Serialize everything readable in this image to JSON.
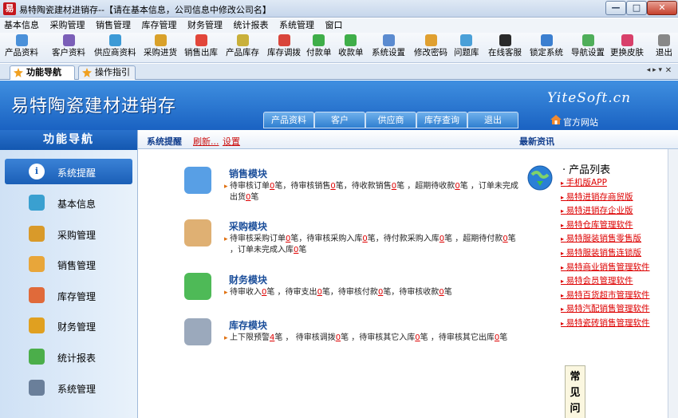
{
  "window": {
    "icon_text": "易",
    "title": "易特陶瓷建材进销存--【请在基本信息，公司信息中修改公司名】",
    "min": "—",
    "max": "□",
    "close": "✕"
  },
  "menu": [
    "基本信息",
    "采购管理",
    "销售管理",
    "库存管理",
    "财务管理",
    "统计报表",
    "系统管理",
    "窗口"
  ],
  "toolbar": [
    {
      "label": "产品资料",
      "icon": "product-icon",
      "color": "#4a90d9"
    },
    {
      "label": "客户资料",
      "icon": "customer-icon",
      "color": "#7b5fb8"
    },
    {
      "label": "供应商资料",
      "icon": "supplier-icon",
      "color": "#3c9ad6"
    },
    {
      "label": "采购进货",
      "icon": "purchase-icon",
      "color": "#d9a12a"
    },
    {
      "label": "销售出库",
      "icon": "sales-icon",
      "color": "#e2463a"
    },
    {
      "label": "产品库存",
      "icon": "stock-icon",
      "color": "#c9b03a"
    },
    {
      "label": "库存调拨",
      "icon": "transfer-icon",
      "color": "#d9453b"
    },
    {
      "label": "付款单",
      "icon": "payment-icon",
      "color": "#3fae49"
    },
    {
      "label": "收款单",
      "icon": "receipt-icon",
      "color": "#3fae49"
    },
    {
      "label": "系统设置",
      "icon": "settings-icon",
      "color": "#5b8bd0"
    },
    {
      "label": "修改密码",
      "icon": "password-icon",
      "color": "#e0a030"
    },
    {
      "label": "问题库",
      "icon": "question-icon",
      "color": "#4aa0d8"
    },
    {
      "label": "在线客服",
      "icon": "qq-icon",
      "color": "#2a2a2a"
    },
    {
      "label": "锁定系统",
      "icon": "lock-icon",
      "color": "#3b7fd0"
    },
    {
      "label": "导航设置",
      "icon": "navigation-icon",
      "color": "#4fae5a"
    },
    {
      "label": "更换皮肤",
      "icon": "skin-icon",
      "color": "#d8406a"
    },
    {
      "label": "退出",
      "icon": "exit-icon",
      "color": "#888888"
    }
  ],
  "tabs": {
    "nav": "功能导航",
    "guide": "操作指引",
    "arrows": "◂ ▸ ▾",
    "close": "✕"
  },
  "banner": {
    "title": "易特陶瓷建材进销存",
    "brand": "YiteSoft.cn",
    "buttons": [
      "产品资料",
      "客户",
      "供应商",
      "库存查询",
      "退出"
    ],
    "home": "官方网站"
  },
  "left": {
    "header": "功能导航",
    "items": [
      "系统提醒",
      "基本信息",
      "采购管理",
      "销售管理",
      "库存管理",
      "财务管理",
      "统计报表",
      "系统管理"
    ]
  },
  "content": {
    "title": "系统提醒",
    "refresh": "刷新...",
    "settings": "设置",
    "news": "最新资讯"
  },
  "modules": [
    {
      "title": "销售模块",
      "t1": "待审核订单",
      "n1": "0",
      "t2": "笔，待审核销售",
      "n2": "0",
      "t3": "笔，待收款销售",
      "n3": "0",
      "t4": "笔 ，超期待收款",
      "n4": "0",
      "t5": "笔 ，订单未完成出货",
      "n5": "0",
      "t6": "笔"
    },
    {
      "title": "采购模块",
      "t1": "待审核采购订单",
      "n1": "0",
      "t2": "笔，待审核采购入库",
      "n2": "0",
      "t3": "笔，待付款采购入库",
      "n3": "0",
      "t4": "笔 ，超期待付款",
      "n4": "0",
      "t5": "笔 ，订单未完成入库",
      "n5": "0",
      "t6": "笔"
    },
    {
      "title": "财务模块",
      "t1": "待审收入",
      "n1": "0",
      "t2": "笔 ，待审支出",
      "n2": "0",
      "t3": "笔，待审核付款",
      "n3": "0",
      "t4": "笔，待审核收款",
      "n4": "0",
      "t5": "笔",
      "n5": "",
      "t6": ""
    },
    {
      "title": "库存模块",
      "t1": "上下限预警",
      "n1": "4",
      "t2": "笔 ， 待审核调拨",
      "n2": "0",
      "t3": "笔 ，待审核其它入库",
      "n3": "0",
      "t4": "笔 ，待审核其它出库",
      "n4": "0",
      "t5": "笔",
      "n5": "",
      "t6": ""
    }
  ],
  "products": {
    "title": "产品列表",
    "links": [
      "手机版APP",
      "易特进销存商贸版",
      "易特进销存企业版",
      "易特仓库管理软件",
      "易特服装销售零售版",
      "易特服装销售连锁版",
      "易特商业销售管理软件",
      "易特会员管理软件",
      "易特百货超市管理软件",
      "易特汽配销售管理软件",
      "易特瓷砖销售管理软件"
    ]
  },
  "faq": "常见问"
}
